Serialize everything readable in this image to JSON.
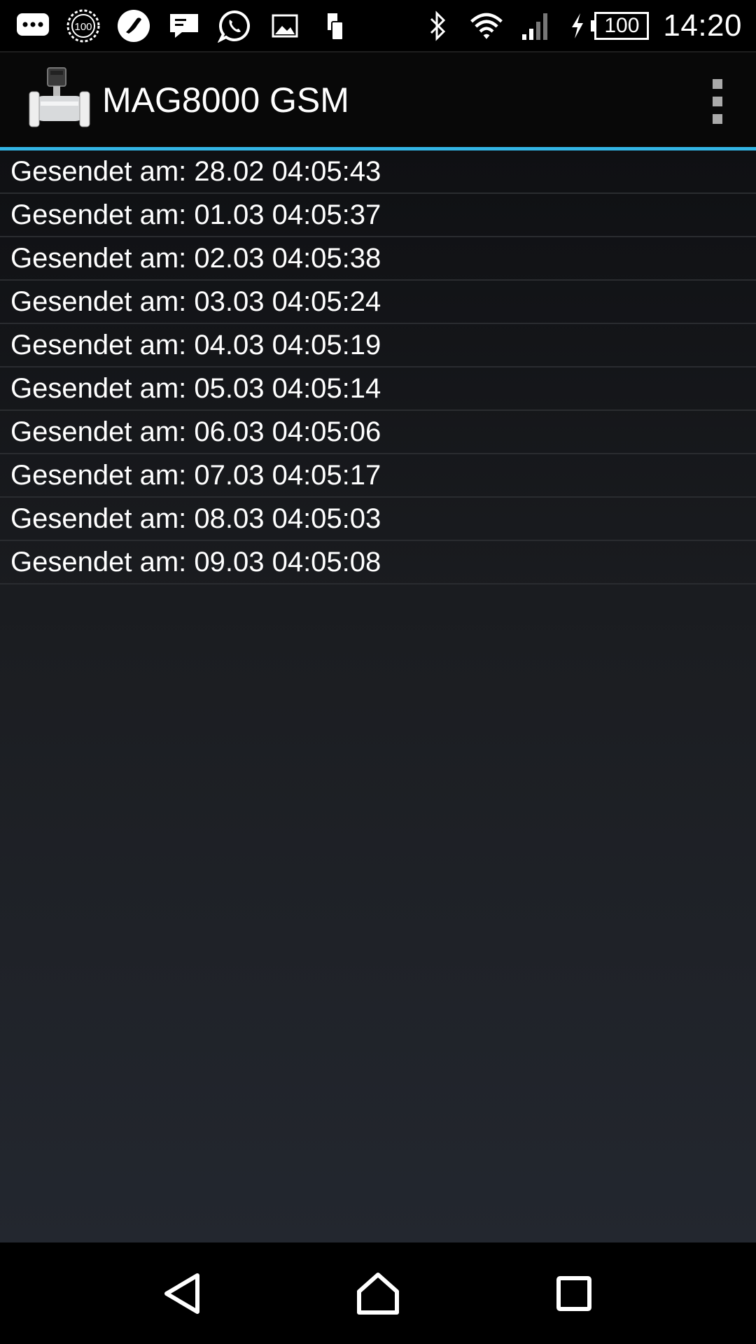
{
  "status_bar": {
    "icons_left": [
      "chat-notification-icon",
      "data-usage-100-icon",
      "music-app-icon",
      "message-icon",
      "whatsapp-icon",
      "gallery-icon",
      "phone-device-icon"
    ],
    "icons_right": [
      "bluetooth-icon",
      "wifi-icon",
      "cellular-signal-icon",
      "charging-icon"
    ],
    "battery_level": "100",
    "time": "14:20"
  },
  "action_bar": {
    "title": "MAG8000 GSM",
    "logo": "flow-meter-icon",
    "overflow_menu": "overflow-menu-icon"
  },
  "list": {
    "items": [
      {
        "label": "Gesendet am: 28.02 04:05:43"
      },
      {
        "label": "Gesendet am: 01.03 04:05:37"
      },
      {
        "label": "Gesendet am: 02.03 04:05:38"
      },
      {
        "label": "Gesendet am: 03.03 04:05:24"
      },
      {
        "label": "Gesendet am: 04.03 04:05:19"
      },
      {
        "label": "Gesendet am: 05.03 04:05:14"
      },
      {
        "label": "Gesendet am: 06.03 04:05:06"
      },
      {
        "label": "Gesendet am: 07.03 04:05:17"
      },
      {
        "label": "Gesendet am: 08.03 04:05:03"
      },
      {
        "label": "Gesendet am: 09.03 04:05:08"
      }
    ]
  },
  "nav_bar": {
    "buttons": [
      "back-icon",
      "home-icon",
      "recents-icon"
    ]
  },
  "colors": {
    "accent": "#33b5e5",
    "action_bar_bg": "#080808",
    "divider": "#2a2c30"
  }
}
